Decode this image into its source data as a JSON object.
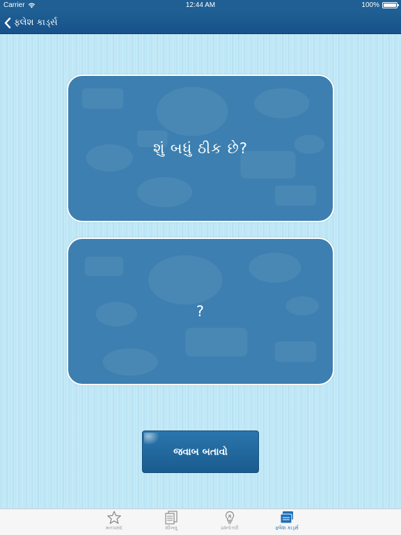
{
  "status_bar": {
    "carrier": "Carrier",
    "time": "12:44 AM",
    "battery": "100%"
  },
  "nav_bar": {
    "back_label": "ફ્લેશ કાર્ડ્સ"
  },
  "cards": {
    "question": "શું બધું ઠીક છે?",
    "answer": "?"
  },
  "show_answer_button": {
    "label": "જવાબ બતાવો"
  },
  "tab_bar": {
    "items": [
      {
        "label": "મનપસંદ",
        "icon": "star-icon",
        "active": false
      },
      {
        "label": "શીખવુ",
        "icon": "document-icon",
        "active": false
      },
      {
        "label": "પ્રશ્નોત્તરી",
        "icon": "lightbulb-icon",
        "active": false
      },
      {
        "label": "ફ્લેશ કાર્ડ્સ",
        "icon": "flashcards-icon",
        "active": true
      }
    ]
  },
  "colors": {
    "nav_bar": "#1f5f93",
    "card": "#3c7fb0",
    "button": "#1f6aa0",
    "active_tab": "#1c6fb8",
    "background": "#bfe7f6"
  }
}
